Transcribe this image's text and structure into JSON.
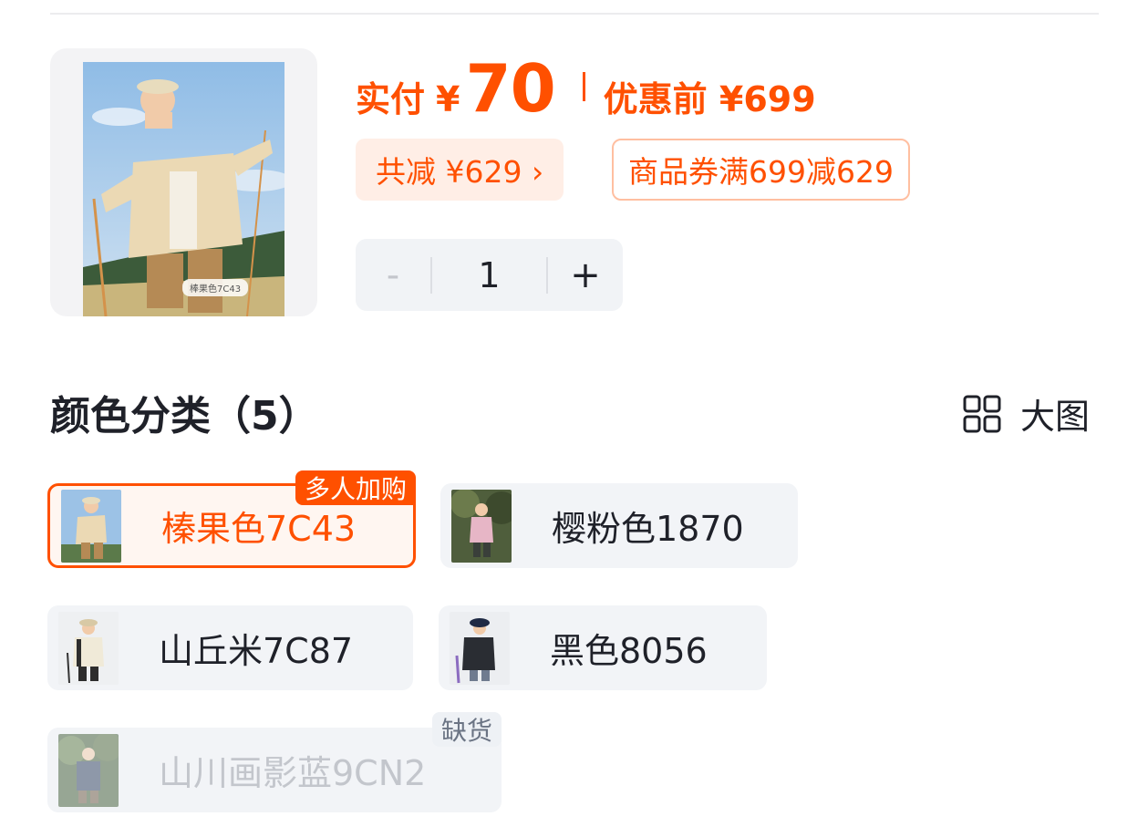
{
  "product": {
    "thumb_tag": "棒果色7C43",
    "price_label": "实付",
    "currency": "¥",
    "price_paid": "70",
    "price_before": "优惠前 ¥699",
    "discount_chip": "共减 ¥629 ›",
    "coupon_chip": "商品券满699减629"
  },
  "quantity": {
    "minus": "-",
    "value": "1",
    "plus": "+"
  },
  "color_section": {
    "title": "颜色分类（5）",
    "big_view_label": "大图",
    "options": [
      {
        "label": "榛果色7C43",
        "badge": "多人加购",
        "selected": true,
        "available": true
      },
      {
        "label": "樱粉色1870",
        "selected": false,
        "available": true
      },
      {
        "label": "山丘米7C87",
        "selected": false,
        "available": true
      },
      {
        "label": "黑色8056",
        "selected": false,
        "available": true
      },
      {
        "label": "山川画影蓝9CN2",
        "badge": "缺货",
        "selected": false,
        "available": false
      }
    ]
  },
  "colors": {
    "accent": "#ff5000",
    "accent_bg": "#ffeee6",
    "chip_bg": "#f2f4f7",
    "text": "#1f2129",
    "disabled_text": "#c3c6cc"
  },
  "icons": {
    "big_view": "grid-2x2-icon",
    "stepper_minus": "minus-icon",
    "stepper_plus": "plus-icon"
  }
}
